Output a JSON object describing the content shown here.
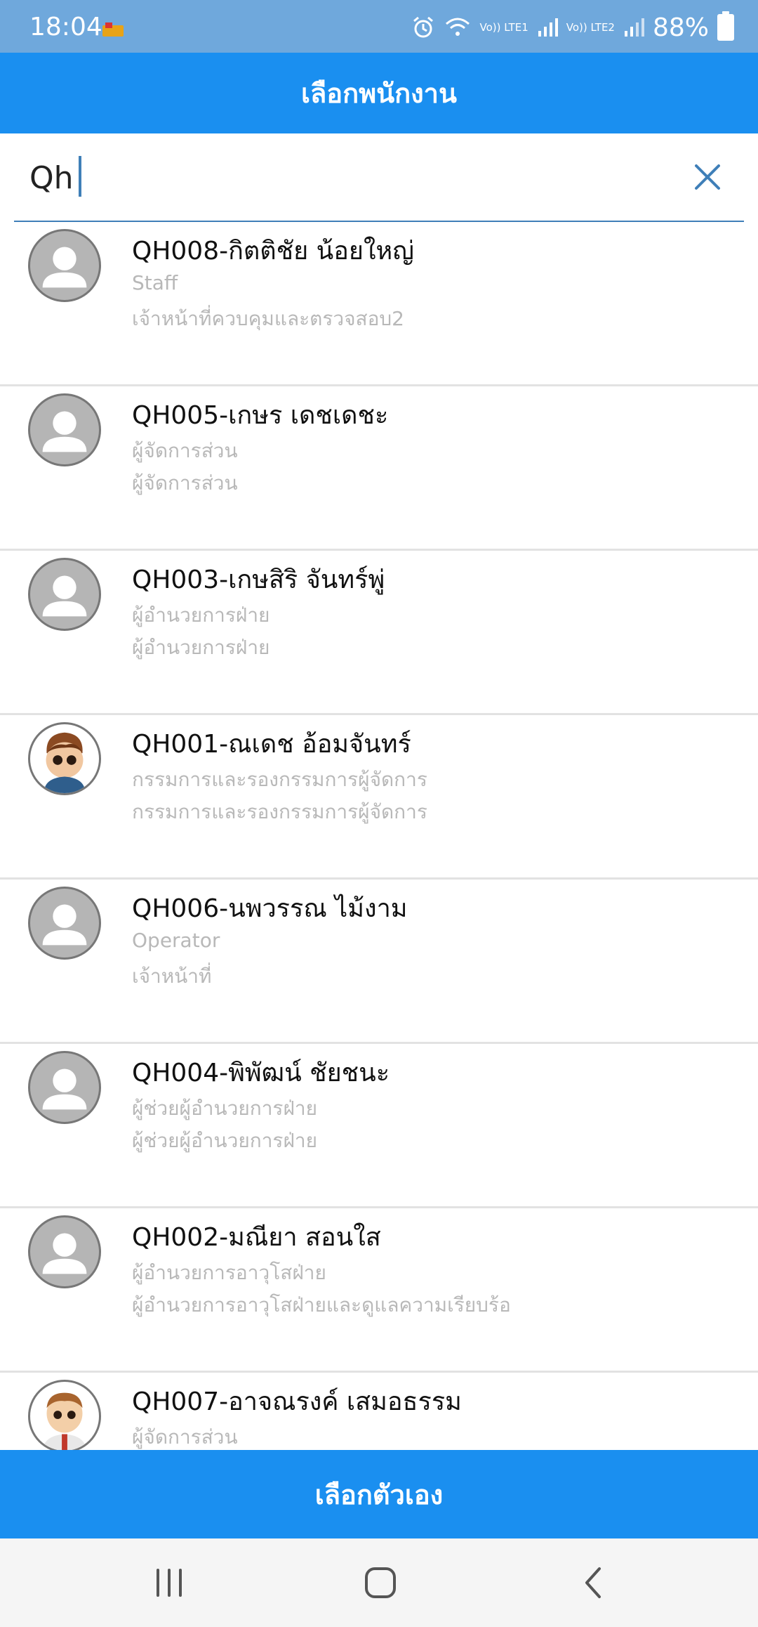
{
  "status_bar": {
    "time": "18:04",
    "net1": "Vo)) LTE1",
    "net2": "Vo)) LTE2",
    "battery": "88%"
  },
  "header": {
    "title": "เลือกพนักงาน"
  },
  "search": {
    "value": "Qh"
  },
  "employees": [
    {
      "name": "QH008-กิตติชัย น้อยใหญ่",
      "line1": "Staff",
      "line2": "เจ้าหน้าที่ควบคุมและตรวจสอบ2",
      "avatar": "placeholder"
    },
    {
      "name": "QH005-เกษร เดชเดชะ",
      "line1": "ผู้จัดการส่วน",
      "line2": "ผู้จัดการส่วน",
      "avatar": "placeholder"
    },
    {
      "name": "QH003-เกษสิริ จันทร์พู่",
      "line1": "ผู้อำนวยการฝ่าย",
      "line2": "ผู้อำนวยการฝ่าย",
      "avatar": "placeholder"
    },
    {
      "name": "QH001-ณเดช อ้อมจันทร์",
      "line1": "กรรมการและรองกรรมการผู้จัดการ",
      "line2": "กรรมการและรองกรรมการผู้จัดการ",
      "avatar": "photo"
    },
    {
      "name": "QH006-นพวรรณ ไม้งาม",
      "line1": "Operator",
      "line2": "เจ้าหน้าที่",
      "avatar": "placeholder"
    },
    {
      "name": "QH004-พิพัฒน์ ชัยชนะ",
      "line1": "ผู้ช่วยผู้อำนวยการฝ่าย",
      "line2": "ผู้ช่วยผู้อำนวยการฝ่าย",
      "avatar": "placeholder"
    },
    {
      "name": "QH002-มณียา สอนใส",
      "line1": "ผู้อำนวยการอาวุโสฝ่าย",
      "line2": "ผู้อำนวยการอาวุโสฝ่ายและดูแลความเรียบร้อ",
      "avatar": "placeholder"
    },
    {
      "name": "QH007-อาจณรงค์ เสมอธรรม",
      "line1": "ผู้จัดการส่วน",
      "line2": "",
      "avatar": "photo"
    }
  ],
  "footer": {
    "select_self_label": "เลือกตัวเอง"
  },
  "colors": {
    "primary": "#1a8ff0",
    "status_bar": "#6fa8dc",
    "divider": "#e2e2e2",
    "subtext": "#b8b8b8"
  },
  "icons": {
    "clear": "close-icon",
    "placeholder_avatar": "person-icon",
    "nav_recents": "recents-icon",
    "nav_home": "home-icon",
    "nav_back": "back-icon"
  }
}
